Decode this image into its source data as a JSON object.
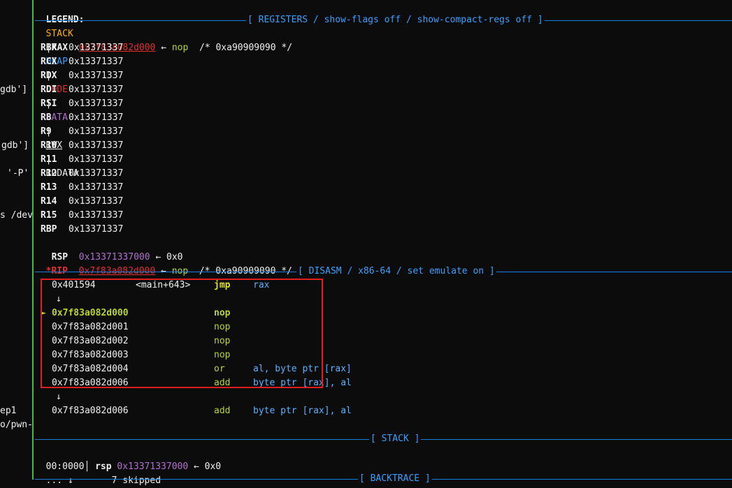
{
  "left_pane": {
    "fragments": [
      "gdb']",
      "gdb']",
      "'-P'",
      "s /dev",
      "ep1",
      "o/pwn-"
    ]
  },
  "legend": {
    "label": "LEGEND:",
    "stack": "STACK",
    "heap": "HEAP",
    "code": "CODE",
    "data": "DATA",
    "rwx": "RWX",
    "rodata": "RODATA",
    "sep": "|"
  },
  "sections": {
    "registers": "[ REGISTERS / show-flags off / show-compact-regs off ]",
    "disasm": "[ DISASM / x86-64 / set emulate on ]",
    "stack": "[ STACK ]",
    "backtrace": "[ BACKTRACE ]"
  },
  "registers": {
    "rax": {
      "name": "RAX",
      "addr": "0x7f83a082d000",
      "arrow": "←",
      "instr": "nop",
      "comment": "/* 0xa90909090 */"
    },
    "plain": [
      {
        "name": "RBX",
        "value": "0x13371337"
      },
      {
        "name": "RCX",
        "value": "0x13371337"
      },
      {
        "name": "RDX",
        "value": "0x13371337"
      },
      {
        "name": "RDI",
        "value": "0x13371337"
      },
      {
        "name": "RSI",
        "value": "0x13371337"
      },
      {
        "name": "R8",
        "value": "0x13371337"
      },
      {
        "name": "R9",
        "value": "0x13371337"
      },
      {
        "name": "R10",
        "value": "0x13371337"
      },
      {
        "name": "R11",
        "value": "0x13371337"
      },
      {
        "name": "R12",
        "value": "0x13371337"
      },
      {
        "name": "R13",
        "value": "0x13371337"
      },
      {
        "name": "R14",
        "value": "0x13371337"
      },
      {
        "name": "R15",
        "value": "0x13371337"
      },
      {
        "name": "RBP",
        "value": "0x13371337"
      }
    ],
    "rsp": {
      "name": "RSP",
      "addr": "0x13371337000",
      "arrow": "←",
      "target": "0x0"
    },
    "rip": {
      "star": "*",
      "name": "RIP",
      "addr": "0x7f83a082d000",
      "arrow": "←",
      "instr": "nop",
      "comment": "/* 0xa90909090 */"
    }
  },
  "disasm": {
    "rows": [
      {
        "marker": "",
        "addr": "0x401594",
        "sym": "<main+643>",
        "mnem": "jmp",
        "ops": "rax"
      },
      {
        "marker": "↓",
        "addr": "",
        "sym": "",
        "mnem": "",
        "ops": ""
      },
      {
        "marker": "►",
        "addr": "0x7f83a082d000",
        "sym": "",
        "mnem": "nop",
        "ops": ""
      },
      {
        "marker": "",
        "addr": "0x7f83a082d001",
        "sym": "",
        "mnem": "nop",
        "ops": ""
      },
      {
        "marker": "",
        "addr": "0x7f83a082d002",
        "sym": "",
        "mnem": "nop",
        "ops": ""
      },
      {
        "marker": "",
        "addr": "0x7f83a082d003",
        "sym": "",
        "mnem": "nop",
        "ops": ""
      },
      {
        "marker": "",
        "addr": "0x7f83a082d004",
        "sym": "",
        "mnem": "or",
        "ops": "al, byte ptr [rax]"
      },
      {
        "marker": "",
        "addr": "0x7f83a082d006",
        "sym": "",
        "mnem": "add",
        "ops": "byte ptr [rax], al"
      },
      {
        "marker": "↓",
        "addr": "",
        "sym": "",
        "mnem": "",
        "ops": ""
      },
      {
        "marker": "",
        "addr": "0x7f83a082d006",
        "sym": "",
        "mnem": "add",
        "ops": "byte ptr [rax], al"
      }
    ]
  },
  "stack": {
    "row": {
      "offset": "00:0000",
      "sep": "│",
      "reg": "rsp",
      "addr": "0x13371337000",
      "arrow": "←",
      "target": "0x0"
    },
    "skip": {
      "dots": "...",
      "arrow": "↓",
      "text": "7 skipped"
    }
  }
}
